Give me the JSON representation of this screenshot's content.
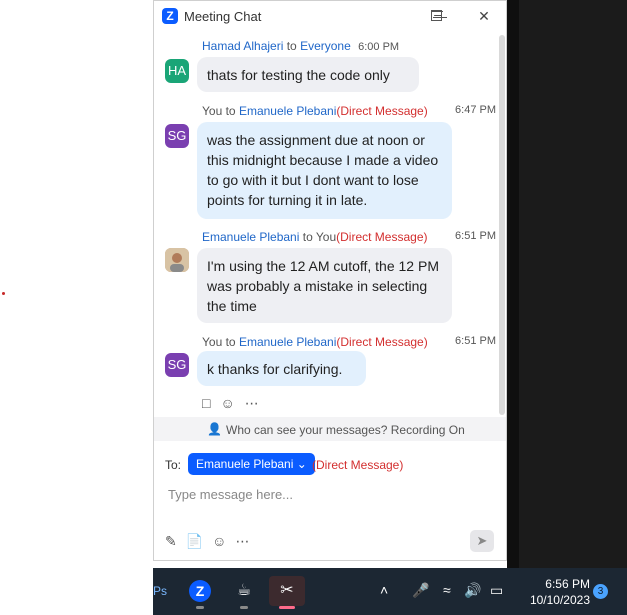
{
  "window": {
    "title": "Meeting Chat",
    "minimize_icon": "minimize-icon",
    "maximize_icon": "maximize-icon",
    "close_icon": "close-icon"
  },
  "messages": [
    {
      "sender": "Hamad Alhajeri",
      "connector": "to",
      "recipient": "Everyone",
      "dm": "",
      "time": "6:00 PM",
      "avatar_text": "HA",
      "avatar_color": "#1aa577",
      "text": "thats for testing the code only"
    },
    {
      "sender": "You",
      "connector": "to",
      "recipient": "Emanuele Plebani",
      "dm": "(Direct Message)",
      "time": "6:47 PM",
      "avatar_text": "SG",
      "avatar_color": "#7a3fb0",
      "text": "was the assignment due at noon or this midnight because I made a video to go with it but I dont want to lose points for turning it in late."
    },
    {
      "sender": "Emanuele Plebani",
      "connector": "to",
      "recipient": "You",
      "dm": "(Direct Message)",
      "time": "6:51 PM",
      "avatar_text": "",
      "avatar_color": "#c9a27a",
      "text": "I'm using the 12 AM cutoff, the 12 PM was probably a mistake in selecting the time"
    },
    {
      "sender": "You",
      "connector": "to",
      "recipient": "Emanuele Plebani",
      "dm": "(Direct Message)",
      "time": "6:51 PM",
      "avatar_text": "SG",
      "avatar_color": "#7a3fb0",
      "text": "k thanks for clarifying."
    }
  ],
  "reactions": [
    "reply-icon",
    "emoji-add-icon",
    "more-icon"
  ],
  "privacy_text": "Who can see your messages? Recording On",
  "composer": {
    "to_label": "To:",
    "recipient": "Emanuele Plebani",
    "dm": "(Direct Message)",
    "placeholder": "Type message here...",
    "tools": [
      "format-icon",
      "file-icon",
      "emoji-icon",
      "more-icon"
    ],
    "send_icon": "send-icon"
  },
  "taskbar": {
    "apps": [
      "photoshop-icon",
      "zoom-icon",
      "java-icon",
      "snipping-tool-icon"
    ],
    "tray_icons": [
      "chevron-up-icon",
      "microphone-icon",
      "wifi-icon",
      "volume-icon",
      "battery-icon"
    ],
    "time": "6:56 PM",
    "date": "10/10/2023",
    "notification_count": "3"
  }
}
